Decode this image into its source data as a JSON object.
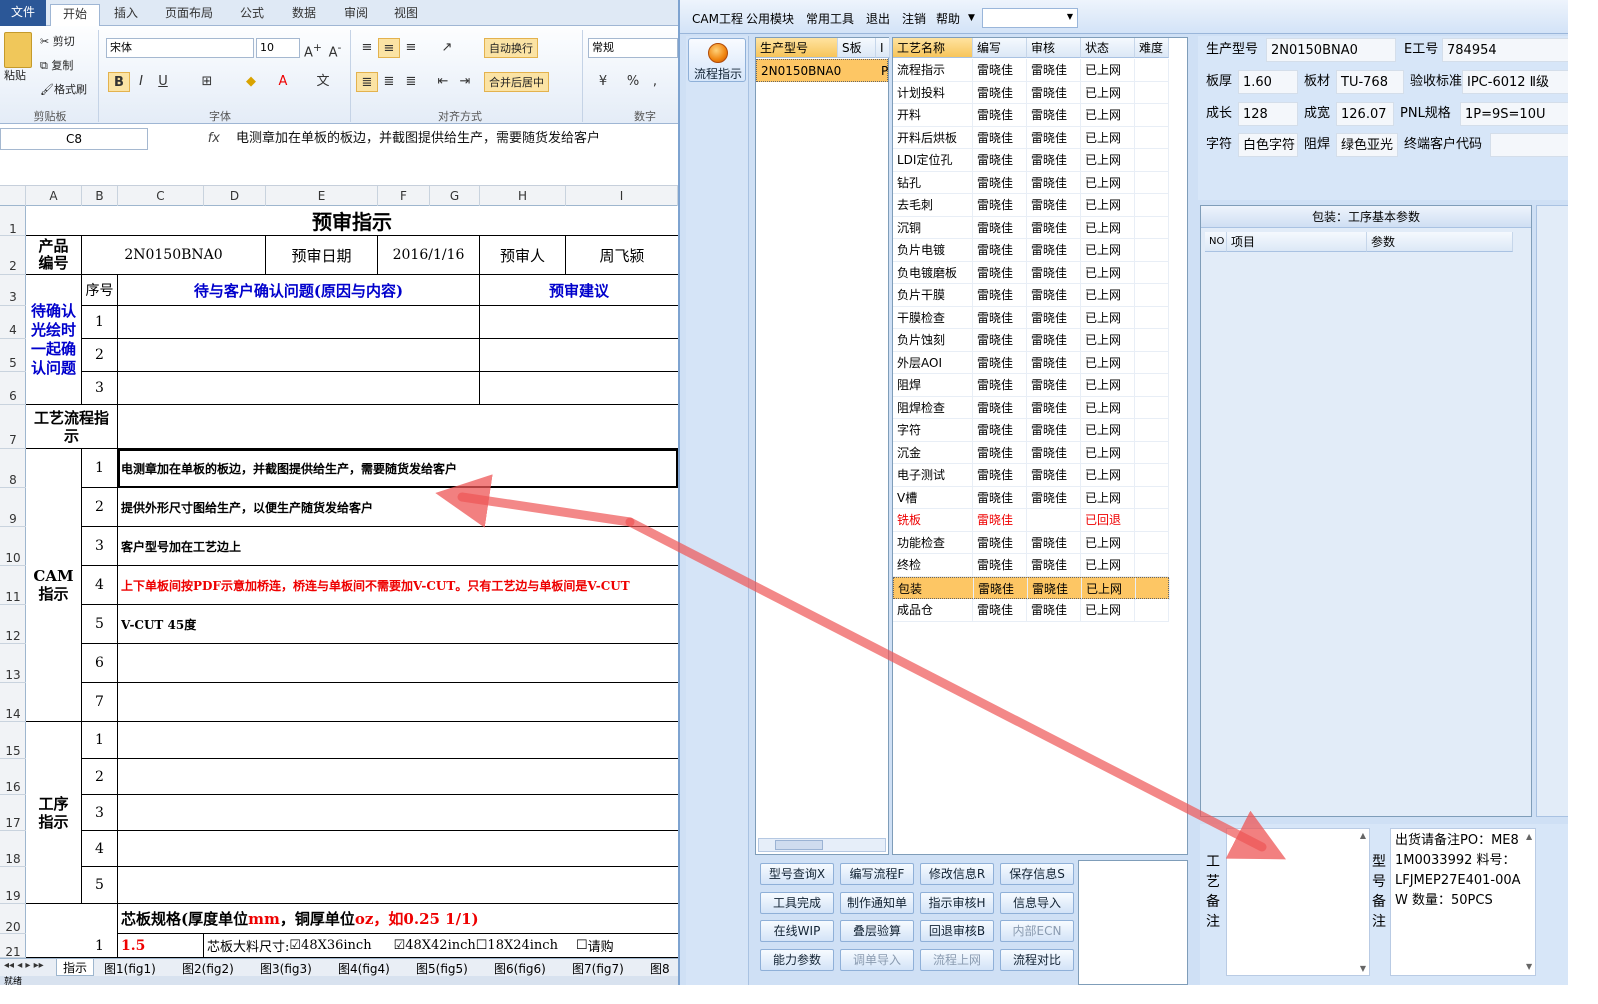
{
  "excel": {
    "tabs": [
      "文件",
      "开始",
      "插入",
      "页面布局",
      "公式",
      "数据",
      "审阅",
      "视图"
    ],
    "clipboard": {
      "paste": "粘贴",
      "cut": "剪切",
      "copy": "复制",
      "format_painter": "格式刷",
      "group": "剪贴板"
    },
    "font": {
      "name": "宋体",
      "size": "10",
      "group": "字体"
    },
    "alignment": {
      "wrap": "自动换行",
      "merge": "合并后居中",
      "group": "对齐方式"
    },
    "number": {
      "format": "常规",
      "group": "数字"
    },
    "name_box": "C8",
    "fx": "fx",
    "formula_text": "电测章加在单板的板边，并截图提供给生产，需要随货发给客户",
    "columns": [
      "A",
      "B",
      "C",
      "D",
      "E",
      "F",
      "G",
      "H",
      "I"
    ],
    "rows": [
      "1",
      "2",
      "3",
      "4",
      "5",
      "6",
      "7",
      "8",
      "9",
      "10",
      "11",
      "12",
      "13",
      "14",
      "15",
      "16",
      "17",
      "18",
      "19",
      "20",
      "21"
    ],
    "sheet": {
      "title": "预审指示",
      "product_label": "产品编号",
      "product_no": "2N0150BNA0",
      "review_date_label": "预审日期",
      "review_date": "2016/1/16",
      "reviewer_label": "预审人",
      "reviewer": "周飞颍",
      "confirm_label": "待确认光绘时一起确认问题",
      "seq_label": "序号",
      "issue_header": "待与客户确认问题(原因与内容)",
      "advice_header": "预审建议",
      "seq_1": "1",
      "seq_2": "2",
      "seq_3": "3",
      "seq_4": "4",
      "seq_5": "5",
      "seq_6": "6",
      "seq_7": "7",
      "process_label": "工艺流程指示",
      "cam_label": "CAM指示",
      "cam_1": "电测章加在单板的板边，并截图提供给生产，需要随货发给客户",
      "cam_2": "提供外形尺寸图给生产，以便生产随货发给客户",
      "cam_3": "客户型号加在工艺边上",
      "cam_4": "上下单板间按PDF示意加桥连，桥连与单板间不需要加V-CUT。只有工艺边与单板间是V-CUT",
      "cam_5": "V-CUT 45度",
      "step_label": "工序指示",
      "core_spec_prefix": "芯板规格(厚度单位",
      "core_spec_mm": "mm",
      "core_spec_mid": "，铜厚单位",
      "core_spec_oz": "oz",
      "core_spec_example": "，如0.25 1/1)",
      "core_val": "1.5",
      "core_size_label": "芯板大料尺寸:",
      "opt_1": "48X36inch",
      "opt_2": "48X42inch",
      "opt_3": "18X24inch",
      "opt_4": "请购"
    },
    "sheet_tabs": [
      "指示",
      "图1(fig1)",
      "图2(fig2)",
      "图3(fig3)",
      "图4(fig4)",
      "图5(fig5)",
      "图6(fig6)",
      "图7(fig7)",
      "图8"
    ],
    "status": "就绪"
  },
  "cam": {
    "menu": [
      "CAM工程",
      "公用模块",
      "常用工具",
      "退出",
      "注销",
      "帮助"
    ],
    "flow_button": "流程指示",
    "list_headers": [
      "生产型号",
      "S板",
      "I"
    ],
    "list_rows": [
      {
        "model": "2N0150BNA0",
        "s": "P"
      }
    ],
    "proc_headers": [
      "工艺名称",
      "编写",
      "审核",
      "状态",
      "难度"
    ],
    "processes": [
      {
        "name": "流程指示",
        "writer": "雷晓佳",
        "checker": "雷晓佳",
        "status": "已上网"
      },
      {
        "name": "计划投料",
        "writer": "雷晓佳",
        "checker": "雷晓佳",
        "status": "已上网"
      },
      {
        "name": "开料",
        "writer": "雷晓佳",
        "checker": "雷晓佳",
        "status": "已上网"
      },
      {
        "name": "开料后烘板",
        "writer": "雷晓佳",
        "checker": "雷晓佳",
        "status": "已上网"
      },
      {
        "name": "LDI定位孔",
        "writer": "雷晓佳",
        "checker": "雷晓佳",
        "status": "已上网"
      },
      {
        "name": "钻孔",
        "writer": "雷晓佳",
        "checker": "雷晓佳",
        "status": "已上网"
      },
      {
        "name": "去毛刺",
        "writer": "雷晓佳",
        "checker": "雷晓佳",
        "status": "已上网"
      },
      {
        "name": "沉铜",
        "writer": "雷晓佳",
        "checker": "雷晓佳",
        "status": "已上网"
      },
      {
        "name": "负片电镀",
        "writer": "雷晓佳",
        "checker": "雷晓佳",
        "status": "已上网"
      },
      {
        "name": "负电镀磨板",
        "writer": "雷晓佳",
        "checker": "雷晓佳",
        "status": "已上网"
      },
      {
        "name": "负片干膜",
        "writer": "雷晓佳",
        "checker": "雷晓佳",
        "status": "已上网"
      },
      {
        "name": "干膜检查",
        "writer": "雷晓佳",
        "checker": "雷晓佳",
        "status": "已上网"
      },
      {
        "name": "负片蚀刻",
        "writer": "雷晓佳",
        "checker": "雷晓佳",
        "status": "已上网"
      },
      {
        "name": "外层AOI",
        "writer": "雷晓佳",
        "checker": "雷晓佳",
        "status": "已上网"
      },
      {
        "name": "阻焊",
        "writer": "雷晓佳",
        "checker": "雷晓佳",
        "status": "已上网"
      },
      {
        "name": "阻焊检查",
        "writer": "雷晓佳",
        "checker": "雷晓佳",
        "status": "已上网"
      },
      {
        "name": "字符",
        "writer": "雷晓佳",
        "checker": "雷晓佳",
        "status": "已上网"
      },
      {
        "name": "沉金",
        "writer": "雷晓佳",
        "checker": "雷晓佳",
        "status": "已上网"
      },
      {
        "name": "电子测试",
        "writer": "雷晓佳",
        "checker": "雷晓佳",
        "status": "已上网"
      },
      {
        "name": "V槽",
        "writer": "雷晓佳",
        "checker": "雷晓佳",
        "status": "已上网"
      },
      {
        "name": "铣板",
        "writer": "雷晓佳",
        "checker": "",
        "status": "已回退"
      },
      {
        "name": "功能检查",
        "writer": "雷晓佳",
        "checker": "雷晓佳",
        "status": "已上网"
      },
      {
        "name": "终检",
        "writer": "雷晓佳",
        "checker": "雷晓佳",
        "status": "已上网"
      },
      {
        "name": "包装",
        "writer": "雷晓佳",
        "checker": "雷晓佳",
        "status": "已上网"
      },
      {
        "name": "成品仓",
        "writer": "雷晓佳",
        "checker": "雷晓佳",
        "status": "已上网"
      }
    ],
    "selected_process": "包装",
    "returned_process": "铣板",
    "buttons": [
      [
        "型号查询X",
        "编写流程F",
        "修改信息R",
        "保存信息S"
      ],
      [
        "工具完成",
        "制作通知单",
        "指示审核H",
        "信息导入"
      ],
      [
        "在线WIP",
        "叠层验算",
        "回退审核B",
        "内部ECN"
      ],
      [
        "能力参数",
        "调单导入",
        "流程上网",
        "流程对比"
      ]
    ],
    "disabled_buttons": [
      "内部ECN",
      "调单导入",
      "流程上网"
    ],
    "info": {
      "model_label": "生产型号",
      "model": "2N0150BNA0",
      "eno_label": "E工号",
      "eno": "784954",
      "thick_label": "板厚",
      "thick": "1.60",
      "material_label": "板材",
      "material": "TU-768",
      "std_label": "验收标准",
      "std": "IPC-6012 Ⅱ级",
      "len_label": "成长",
      "len": "128",
      "wid_label": "成宽",
      "wid": "126.07",
      "pnl_label": "PNL规格",
      "pnl": "1P=9S=10U",
      "char_label": "字符",
      "char": "白色字符",
      "mask_label": "阻焊",
      "mask": "绿色亚光",
      "cust_label": "终端客户代码",
      "cust": ""
    },
    "param_panel": {
      "title": "包装：工序基本参数",
      "cols": [
        "NO",
        "项目",
        "参数"
      ]
    },
    "process_note_label": "工艺备注",
    "model_note_label": "型号备注",
    "model_note": "出货请备注PO：ME81M0033992 料号：LFJMEP27E401-00AW 数量：50PCS"
  },
  "colors": {
    "selected": "#fdc664",
    "returned": "#e00000",
    "arrow": "#ee5555",
    "link_blue": "#0000cc"
  }
}
